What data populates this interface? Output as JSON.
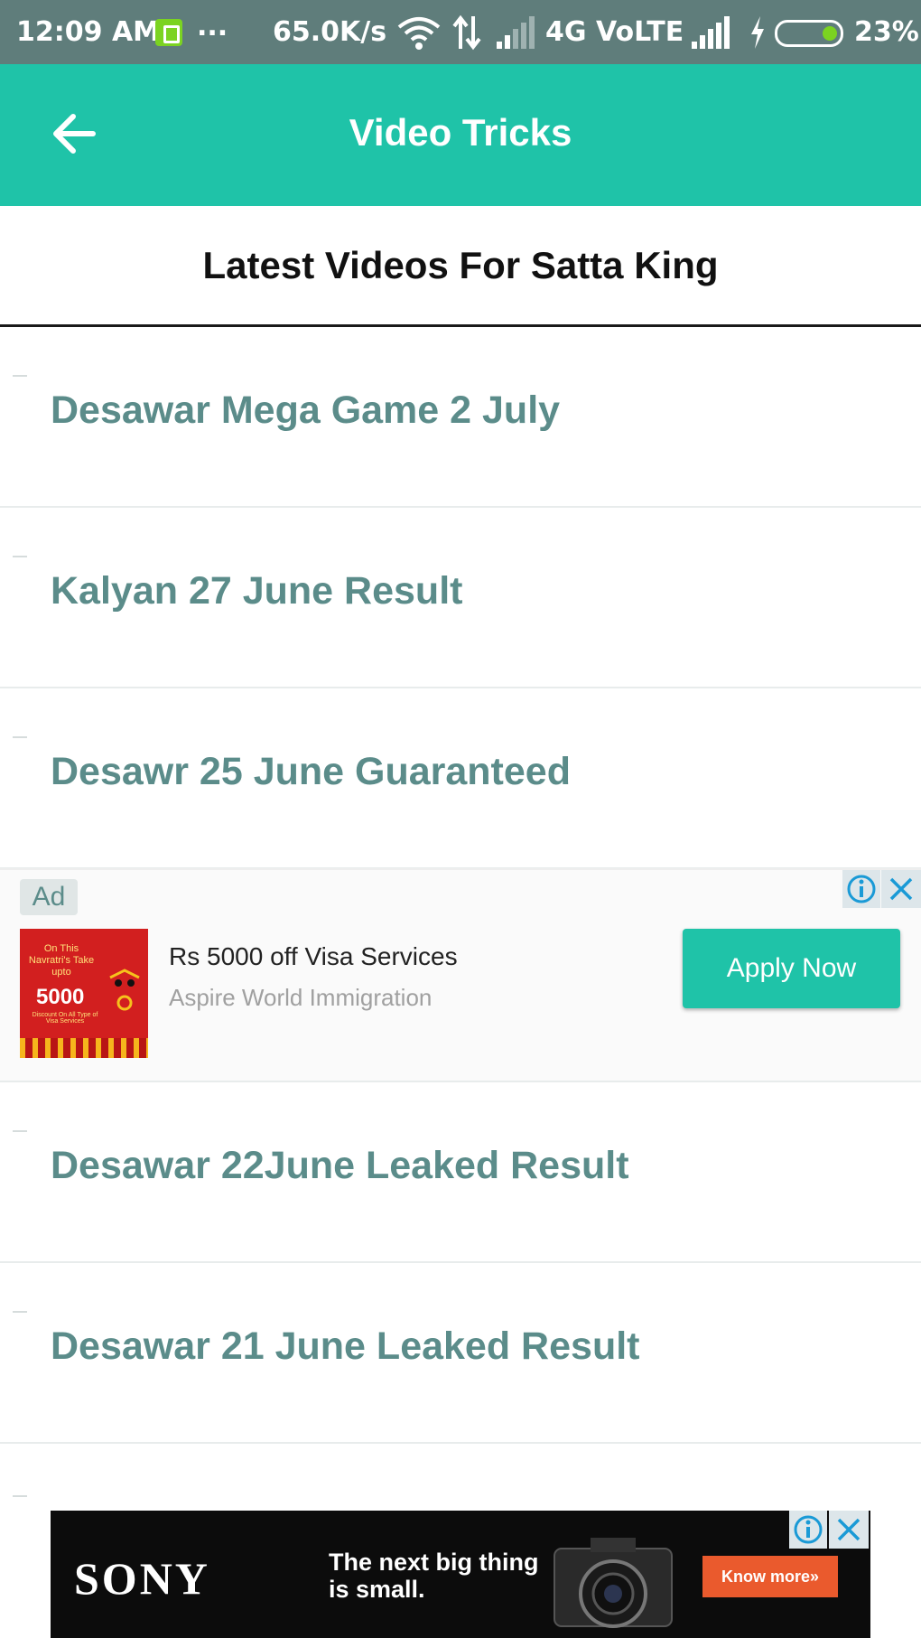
{
  "status_bar": {
    "time": "12:09 AM",
    "more": "...",
    "speed": "65.0K/s",
    "network": "4G VoLTE",
    "battery": "23%"
  },
  "app_bar": {
    "title": "Video Tricks",
    "back_icon": "arrow-back-icon"
  },
  "section": {
    "title": "Latest Videos For Satta King"
  },
  "list": {
    "items": [
      {
        "label": "Desawar Mega Game 2 July"
      },
      {
        "label": "Kalyan 27 June Result"
      },
      {
        "label": "Desawr 25 June Guaranteed"
      },
      {
        "label": "Desawar 22June Leaked Result"
      },
      {
        "label": "Desawar 21 June Leaked Result"
      }
    ]
  },
  "ad_native": {
    "badge": "Ad",
    "title": "Rs 5000 off Visa Services",
    "advertiser": "Aspire World Immigration",
    "cta": "Apply Now",
    "thumb_line1": "On This Navratri's Take upto",
    "thumb_amount": "5000",
    "thumb_line2": "Discount On All Type of Visa Services"
  },
  "ad_banner": {
    "brand": "SONY",
    "tagline_1": "The next big thing",
    "tagline_2": "is small.",
    "cta": "Know more»"
  },
  "colors": {
    "accent": "#1fc3a8",
    "status_bar": "#5f7d7b",
    "list_text": "#5b8c8a"
  }
}
